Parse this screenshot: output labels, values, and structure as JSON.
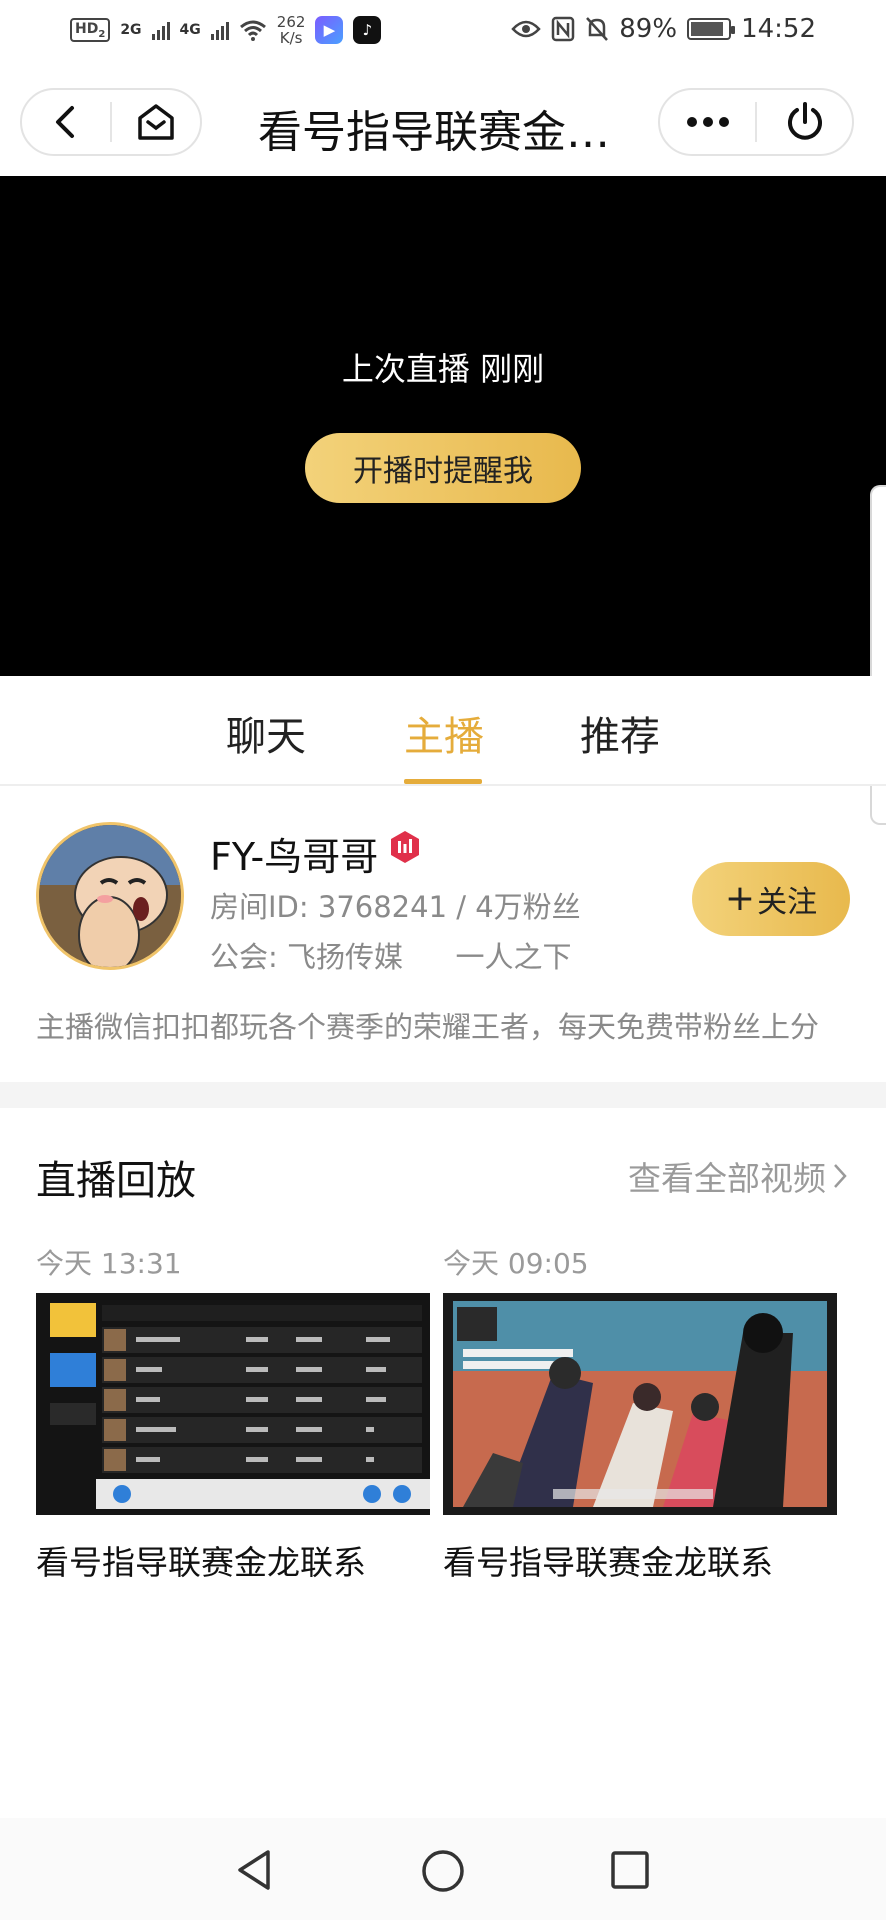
{
  "status_bar": {
    "hd": "HD",
    "hd_sub": "2",
    "net1": "2G",
    "net2": "4G",
    "speed_value": "262",
    "speed_unit": "K/s",
    "battery": "89%",
    "time": "14:52",
    "icons": [
      "vibrate-eye-icon",
      "nfc-icon",
      "mute-icon",
      "battery-icon"
    ]
  },
  "nav": {
    "title": "看号指导联赛金…",
    "icons": [
      "back-icon",
      "home-icon",
      "more-icon",
      "power-icon"
    ]
  },
  "video": {
    "last_live_text": "上次直播 刚刚",
    "remind_button": "开播时提醒我"
  },
  "tabs": [
    {
      "label": "聊天",
      "active": false
    },
    {
      "label": "主播",
      "active": true
    },
    {
      "label": "推荐",
      "active": false
    }
  ],
  "anchor": {
    "name": "FY-鸟哥哥",
    "room_line": "房间ID: 3768241 / 4万粉丝",
    "guild_label": "公会: 飞扬传媒",
    "game": "一人之下",
    "follow_button": "关注",
    "follow_icon": "+",
    "intro": "主播微信扣扣都玩各个赛季的荣耀王者，每天免费带粉丝上分"
  },
  "replay": {
    "section_title": "直播回放",
    "view_all": "查看全部视频",
    "items": [
      {
        "time": "今天 13:31",
        "title": "看号指导联赛金龙联系"
      },
      {
        "time": "今天 09:05",
        "title": "看号指导联赛金龙联系"
      }
    ]
  },
  "colors": {
    "accent": "#e5ac3b",
    "button_gradient_start": "#f3d27a",
    "button_gradient_end": "#e8b94d",
    "video_bg": "#000000"
  }
}
